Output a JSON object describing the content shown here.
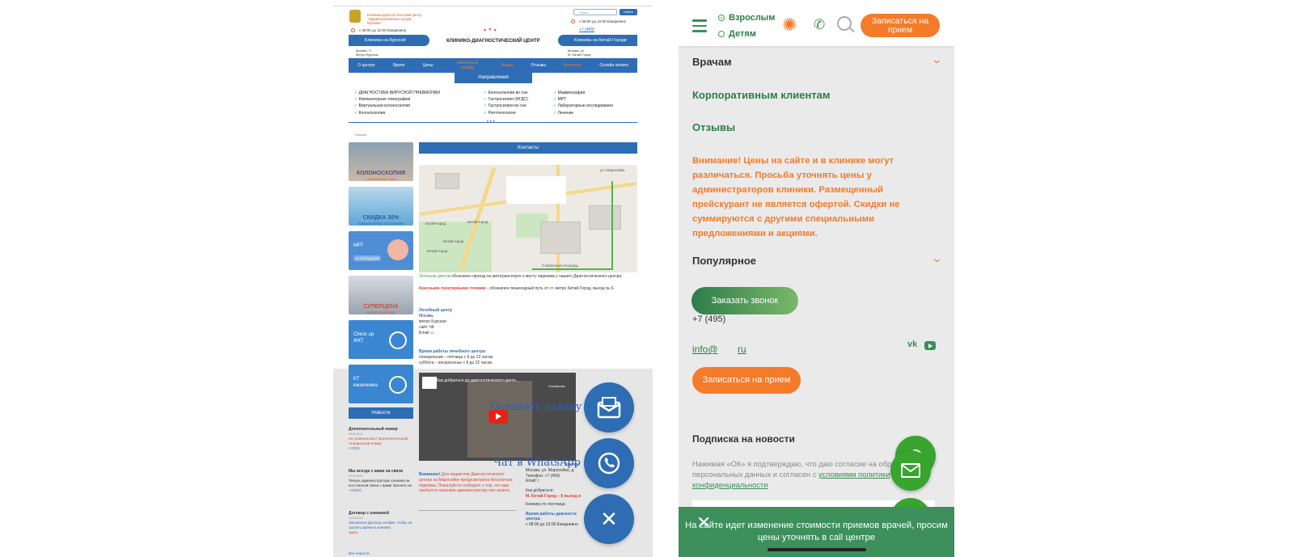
{
  "left": {
    "dept": "Клиника-диагностический центр \"Здравоохранения города Москвы\"",
    "hours_left": "с 08:00 до 22:00 Ежедневно",
    "search_placeholder": "Поиск...",
    "find_label": "Найти",
    "hours_right": "с 08:00 до 22:00 Ежедневно",
    "phone_right": "+7 (499)",
    "clinic_left": "Клиника на Курской",
    "clinic_right": "Клиника на Китай-Городе",
    "center_title": "КЛИНИКО-ДИАГНОСТИЧЕСКИЙ ЦЕНТР",
    "addr_left_1": "Москва, П.",
    "addr_left_2": "Метро Курская",
    "addr_right_1": "Москва, ул.",
    "addr_right_2": "М. Китай-Город",
    "nav": [
      "О центре",
      "Врачи",
      "Цены",
      "Записаться онлайн",
      "Акции",
      "Отзывы",
      "Контакты",
      "Онлайн оплата"
    ],
    "directions_tab": "Направления",
    "dir_col1": [
      "ДИАГНОСТИКА ВИРУСНОЙ ПНЕВМОНИИ",
      "Компьютерная томография",
      "Виртуальная колоноскопия",
      "Колоноскопия"
    ],
    "dir_col2": [
      "Колоноскопия во сне",
      "Гастроскопия (ФГДС)",
      "Гастроскопия во сне",
      "Рентгенология"
    ],
    "dir_col3": [
      "Маммография",
      "МРТ",
      "Лабораторные исследования",
      "Лечение"
    ],
    "breadcrumb": "Главная",
    "banners": [
      {
        "cap": "КОЛОНОСКОПИЯ",
        "sub": "СПЕЦИАЛЬНАЯ ЦЕНА"
      },
      {
        "cap": "СКИДКА 30%",
        "sub": "КОМПЬЮТЕРНАЯ ТОМОГРАФИЯ"
      },
      {
        "cap": "МРТ",
        "sub": "от 2000 рублей"
      },
      {
        "cap": "СУПЕРЦЕНА",
        "sub": "НА ГАСТРОСКОПИЮ"
      },
      {
        "cap": "Check up ЖКТ",
        "sub": ""
      },
      {
        "cap": "КТ кишечника",
        "sub": ""
      }
    ],
    "news_header": "Новости",
    "news": [
      {
        "title": "Дополнительный номер",
        "date": "26.03.2023",
        "body": "Не дозвонились? Дополнительный телефонный номер",
        "phone": "+7(931"
      },
      {
        "title": "Мы всегда с вами на связи",
        "date": "23.03.2023",
        "body": "Теперь администраторы клиники на постоянной связи с вами! Звоните на",
        "phone": "+7(931)"
      },
      {
        "title": "Договор с клиникой",
        "date": "22.03.2023",
        "body": "Заключите Договор онлайн, чтобы не тратить время в клинике,",
        "link": "здесь"
      }
    ],
    "all_news": "Все новости",
    "contacts_header": "Контакты",
    "map_labels": [
      "ул. Маросейка",
      "Китай-город",
      "Китай-город",
      "Китай-город",
      "Китай-город",
      "Славянская площадь"
    ],
    "legend_green_a": "Зеленым цветом",
    "legend_green_b": " обозначен проезд на автотранспорте к месту парковки у нашего Диагностического центра.",
    "legend_red_a": "Красными пунктирными точками",
    "legend_red_b": " - обозначен пешеходный путь от ст. метро Китай-Город, выход № 6.",
    "center_label": "Лечебный центр",
    "center_lines": [
      "Москва,",
      "метро Курская",
      "сайт: htt",
      "Email: c"
    ],
    "worktime_label": "Время работы лечебного центра:",
    "worktime_lines": [
      "понедельник – пятница с 8 до 22 часов,",
      "суббота – воскресенье с 8 до 22 часов."
    ],
    "video_title": "Как добраться до диагностического цента...",
    "video_copy": "Скопирова...",
    "float_order": "Оставить заявку",
    "float_whatsapp": "Чат в WhatsApp",
    "attention_a": "Внимание!",
    "attention_b": " Для пациентов Диагностического центра на Маросейке предусмотрена бесплатная парковка. Пожалуйста сообщите о том, что вам требуется парковка администратору при записи.",
    "bottom_right": [
      "Москва, ул. Маросейка, д.",
      "Телефон: +7 (499)",
      "Email: i",
      "",
      "Как добраться:",
      "М. Китай-Город – 6 выход и",
      "",
      "Клинику по лестнице.",
      "",
      "Время работы диагности",
      "центра:",
      "с 08:00 до 22:00 Ежедневно"
    ],
    "bottom_right_head": "Центр"
  },
  "right": {
    "adult": "Взрослым",
    "children": "Детям",
    "cta_head": "Записаться на прием",
    "menu_doctors": "Врачам",
    "menu_corp": "Корпоративным клиентам",
    "menu_reviews": "Отзывы",
    "warning": "Внимание! Цены на сайте и в клинике могут различаться. Просьба уточнять цены у администраторов клиники. Размещенный прейскурант не является офертой. Скидки не суммируются с другими специальными предложениями и акциями.",
    "popular": "Популярное",
    "order_call": "Заказать звонок",
    "phone": "+7 (495)",
    "email_a": "info@",
    "email_b": "ru",
    "vk": "vk",
    "signup": "Записаться на прием",
    "subscribe_title": "Подписка на новости",
    "consent_a": "Нажимая «ОК» я подтверждаю, что даю согласие на обра",
    "consent_b": "персональных данных и согласен с ",
    "consent_link": "условиями политики конфиденциальности",
    "banner": "На сайте идет изменение стоимости приемов врачей, просим цены уточнять в call центре"
  },
  "colors": {
    "blue": "#2e6db4",
    "orange": "#f47b2a",
    "green": "#3d8f5c",
    "whatsapp": "#37a52e"
  }
}
